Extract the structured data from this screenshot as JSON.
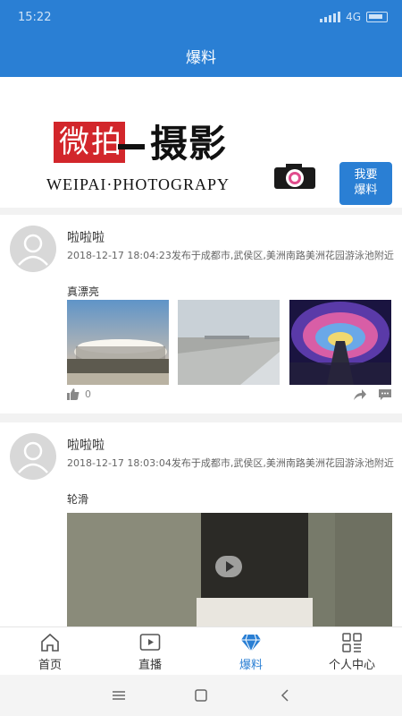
{
  "status": {
    "time": "15:22",
    "network": "4G"
  },
  "header": {
    "title": "爆料"
  },
  "banner": {
    "logo_red_text": "微拍",
    "logo_black_text": "摄影",
    "logo_sub": "WEIPAI·PHOTOGRAPY",
    "report_button": {
      "line1": "我要",
      "line2": "爆料"
    }
  },
  "feed": [
    {
      "username": "啦啦啦",
      "meta": "2018-12-17 18:04:23发布于成都市,武侯区,美洲南路美洲花园游泳池附近",
      "caption": "真漂亮",
      "likes": "0",
      "media": "photos"
    },
    {
      "username": "啦啦啦",
      "meta": "2018-12-17 18:03:04发布于成都市,武侯区,美洲南路美洲花园游泳池附近",
      "caption": "轮滑",
      "media": "video"
    }
  ],
  "tabs": [
    {
      "label": "首页",
      "icon": "home-icon",
      "active": false
    },
    {
      "label": "直播",
      "icon": "play-icon",
      "active": false
    },
    {
      "label": "爆料",
      "icon": "diamond-icon",
      "active": true
    },
    {
      "label": "个人中心",
      "icon": "grid-icon",
      "active": false
    }
  ],
  "colors": {
    "primary": "#2a7fd4",
    "red": "#d2262b"
  }
}
